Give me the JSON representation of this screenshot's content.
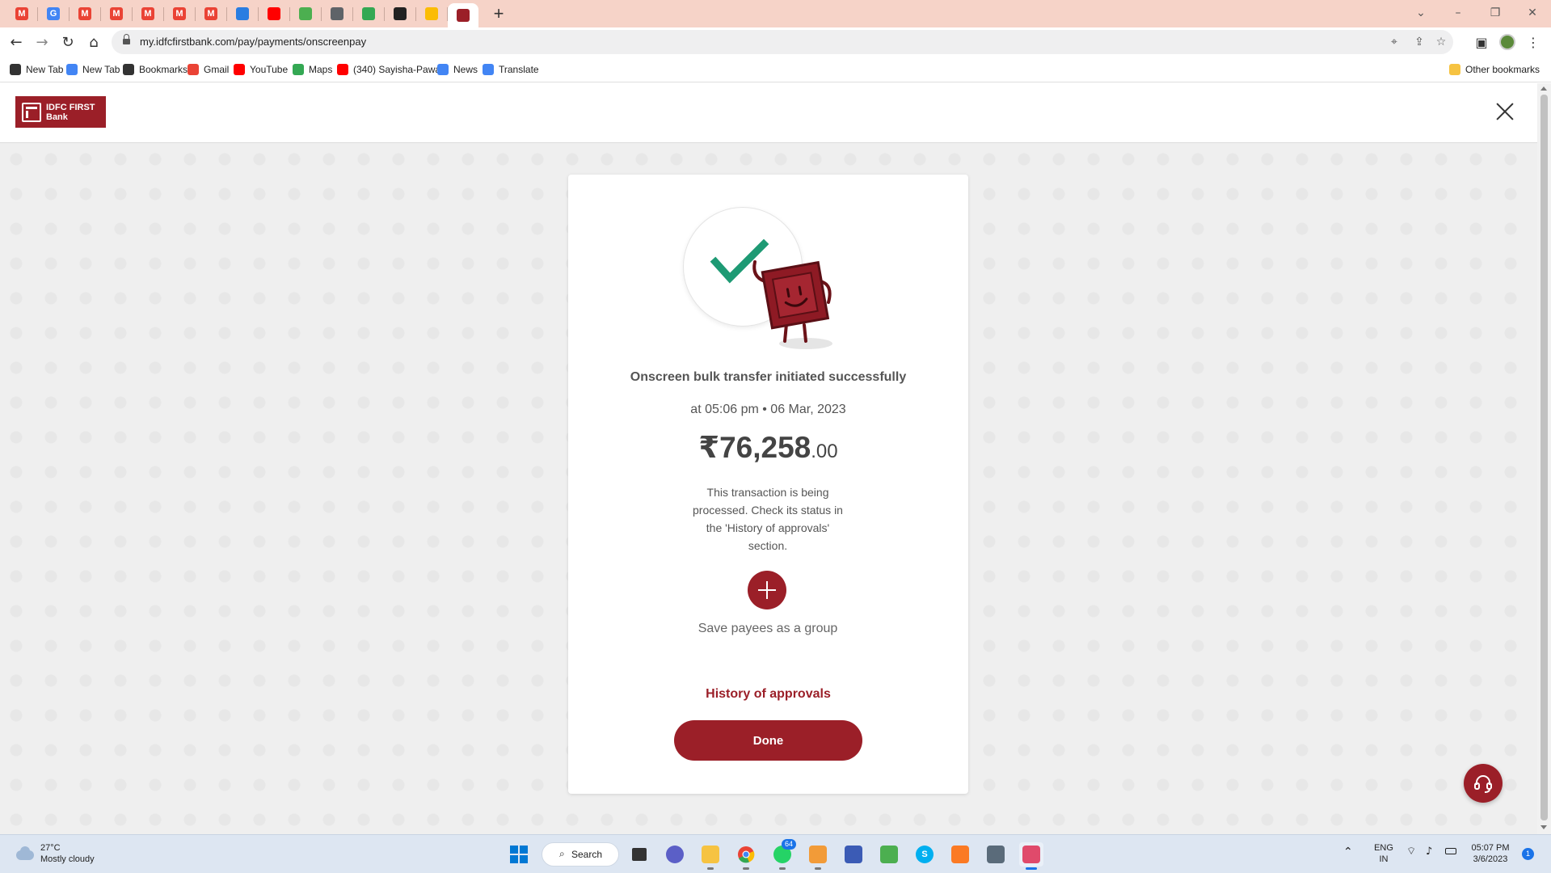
{
  "browser": {
    "tabs": [
      {
        "icon": "gmail-icon",
        "letter": "M",
        "color": "#ea4335"
      },
      {
        "icon": "google-icon",
        "letter": "G",
        "color": "#4285f4"
      },
      {
        "icon": "gmail-icon",
        "letter": "M",
        "color": "#ea4335"
      },
      {
        "icon": "gmail-icon",
        "letter": "M",
        "color": "#ea4335"
      },
      {
        "icon": "gmail-icon",
        "letter": "M",
        "color": "#ea4335"
      },
      {
        "icon": "gmail-icon",
        "letter": "M",
        "color": "#ea4335"
      },
      {
        "icon": "gmail-icon",
        "letter": "M",
        "color": "#ea4335"
      },
      {
        "icon": "app-icon",
        "letter": "",
        "color": "#2a7de1"
      },
      {
        "icon": "youtube-icon",
        "letter": "",
        "color": "#ff0000"
      },
      {
        "icon": "app-icon",
        "letter": "",
        "color": "#4caf50"
      },
      {
        "icon": "flag-icon",
        "letter": "",
        "color": "#5f6368"
      },
      {
        "icon": "play-store-icon",
        "letter": "",
        "color": "#34a853"
      },
      {
        "icon": "github-icon",
        "letter": "",
        "color": "#222222"
      },
      {
        "icon": "drive-icon",
        "letter": "",
        "color": "#fbbc04"
      },
      {
        "icon": "idfc-icon",
        "letter": "",
        "color": "#9b1f28",
        "active": true
      }
    ],
    "url": "my.idfcfirstbank.com/pay/payments/onscreenpay",
    "bookmarks": [
      {
        "label": "New Tab",
        "icon": "globe-icon",
        "color": "#333333"
      },
      {
        "label": "New Tab",
        "icon": "google-icon",
        "color": "#4285f4"
      },
      {
        "label": "Bookmarks",
        "icon": "star-icon",
        "color": "#333333"
      },
      {
        "label": "Gmail",
        "icon": "gmail-icon",
        "color": "#ea4335"
      },
      {
        "label": "YouTube",
        "icon": "youtube-icon",
        "color": "#ff0000"
      },
      {
        "label": "Maps",
        "icon": "maps-icon",
        "color": "#34a853"
      },
      {
        "label": "(340) Sayisha-Pawa...",
        "icon": "youtube-icon",
        "color": "#ff0000"
      },
      {
        "label": "News",
        "icon": "news-icon",
        "color": "#4285f4"
      },
      {
        "label": "Translate",
        "icon": "translate-icon",
        "color": "#4285f4"
      }
    ],
    "other_bookmarks": "Other bookmarks"
  },
  "page": {
    "brand": {
      "line1": "IDFC FIRST",
      "line2": "Bank"
    },
    "title": "Onscreen bulk transfer initiated successfully",
    "timestamp": "at 05:06 pm • 06 Mar, 2023",
    "amount_main": "₹76,258",
    "amount_cents": ".00",
    "info": "This transaction is being processed. Check its status in the 'History of approvals' section.",
    "save_group_label": "Save payees as a group",
    "history_link": "History of approvals",
    "done_label": "Done",
    "accent_color": "#9b1f28"
  },
  "taskbar": {
    "weather_temp": "27°C",
    "weather_desc": "Mostly cloudy",
    "search_label": "Search",
    "whatsapp_badge": "64",
    "lang_line1": "ENG",
    "lang_line2": "IN",
    "time": "05:07 PM",
    "date": "3/6/2023",
    "notification_count": "1"
  }
}
